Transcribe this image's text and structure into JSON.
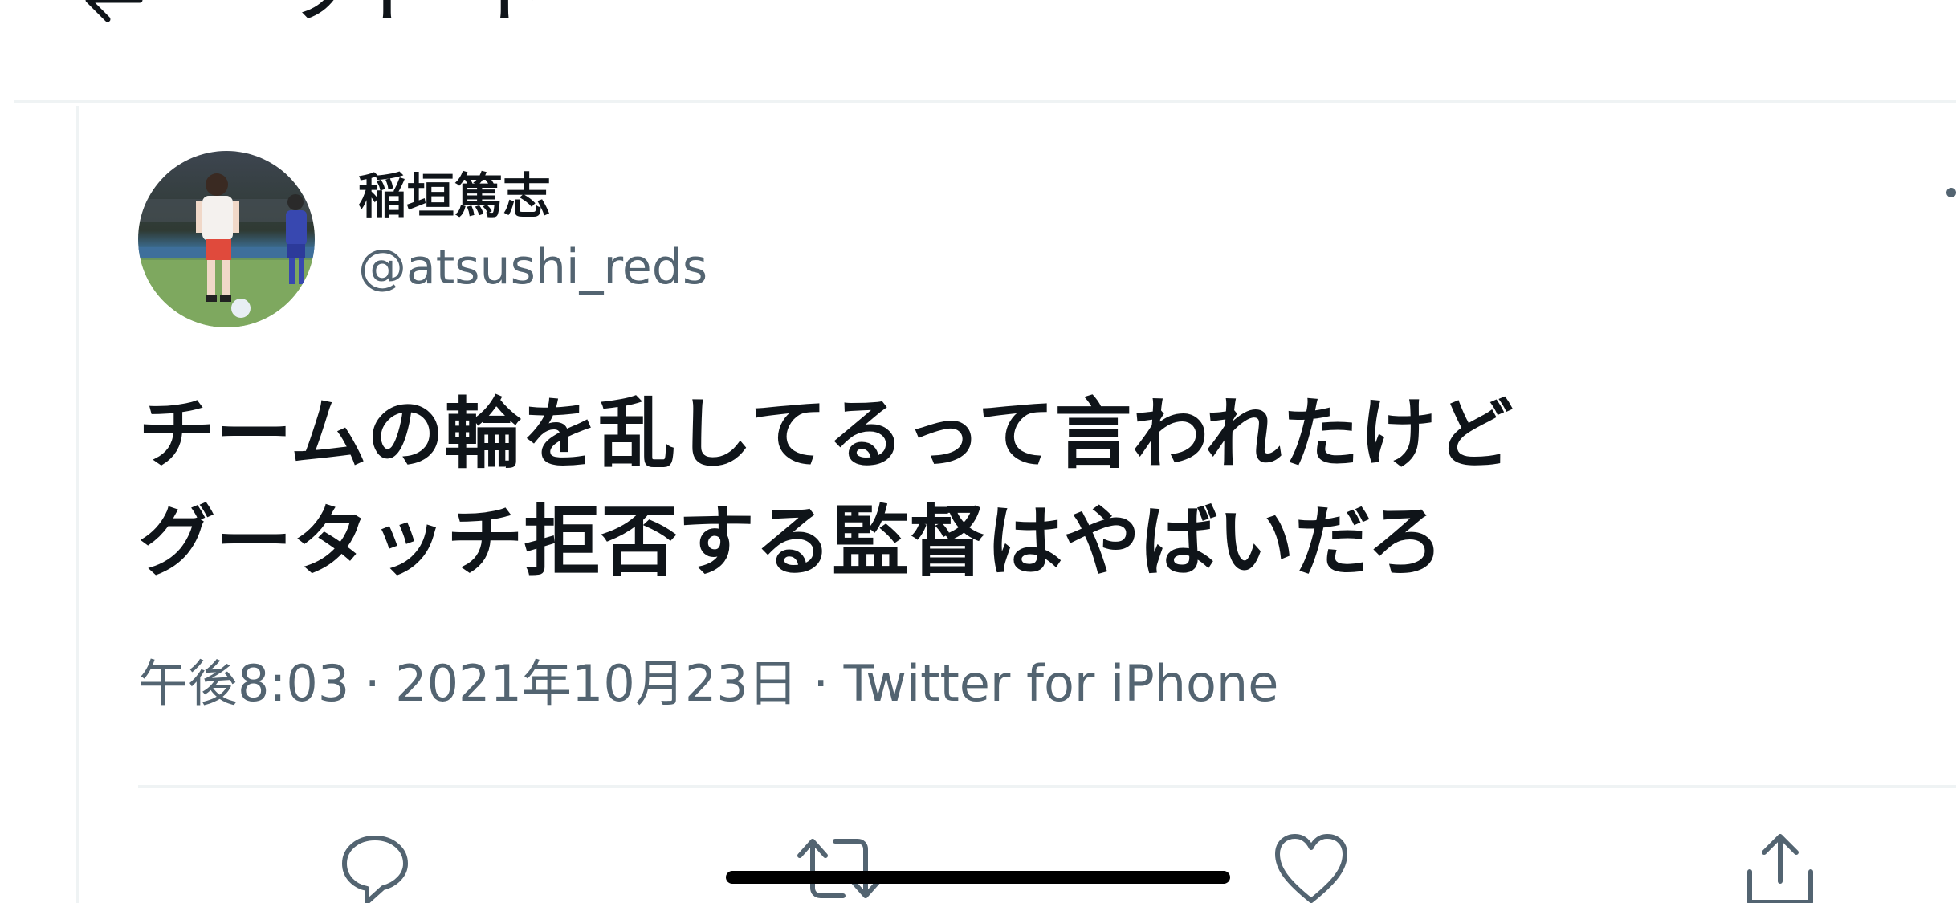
{
  "header": {
    "title": "ツイート",
    "back_icon": "arrow-left-icon"
  },
  "tweet": {
    "author": {
      "name": "稲垣篤志",
      "handle": "@atsushi_reds",
      "avatar": "player-photo-avatar"
    },
    "text_lines": [
      "チームの輪を乱してるって言われたけど",
      "グータッチ拒否する監督はやばいだろ"
    ],
    "meta": {
      "time": "午後8:03",
      "date": "2021年10月23日",
      "source": "Twitter for iPhone",
      "separator": "·"
    }
  },
  "actions": [
    {
      "name": "reply",
      "icon": "reply-icon"
    },
    {
      "name": "retweet",
      "icon": "retweet-icon"
    },
    {
      "name": "like",
      "icon": "heart-icon"
    },
    {
      "name": "share",
      "icon": "share-icon"
    }
  ],
  "colors": {
    "primary_text": "#0f1419",
    "secondary_text": "#536471",
    "divider": "#eff3f4",
    "background": "#ffffff"
  }
}
